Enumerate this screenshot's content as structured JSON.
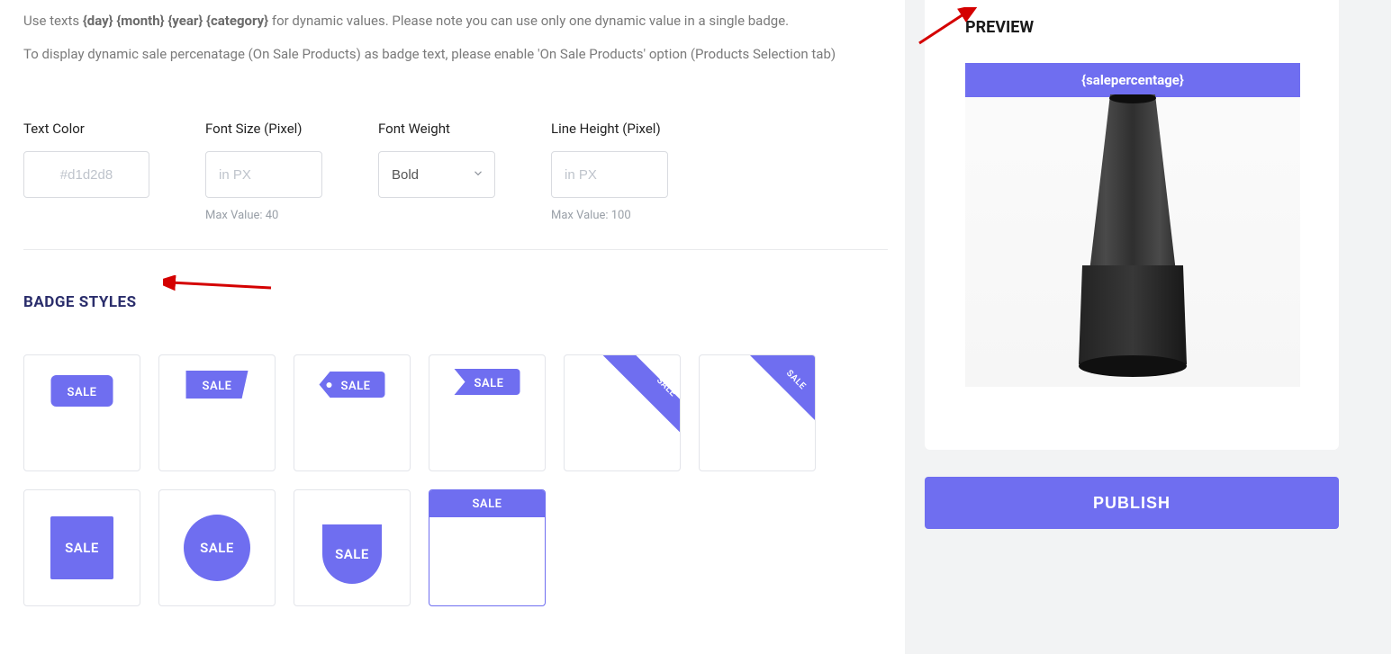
{
  "hint_prefix": "Use texts ",
  "hint_tokens": "{day} {month} {year} {category}",
  "hint_suffix": " for dynamic values. Please note you can use only one dynamic value in a single badge.",
  "hint_line2": "To display dynamic sale percenatage (On Sale Products) as badge text, please enable 'On Sale Products' option (Products Selection tab)",
  "fields": {
    "text_color": {
      "label": "Text Color",
      "placeholder": "#d1d2d8"
    },
    "font_size": {
      "label": "Font Size (Pixel)",
      "placeholder": "in PX",
      "helper": "Max Value: 40"
    },
    "font_weight": {
      "label": "Font Weight",
      "selected": "Bold"
    },
    "line_height": {
      "label": "Line Height (Pixel)",
      "placeholder": "in PX",
      "helper": "Max Value: 100"
    }
  },
  "section_title": "BADGE STYLES",
  "badge_label": "SALE",
  "preview": {
    "title": "PREVIEW",
    "badge_text": "{salepercentage}"
  },
  "publish_label": "PUBLISH",
  "accent": "#6f6ef0"
}
